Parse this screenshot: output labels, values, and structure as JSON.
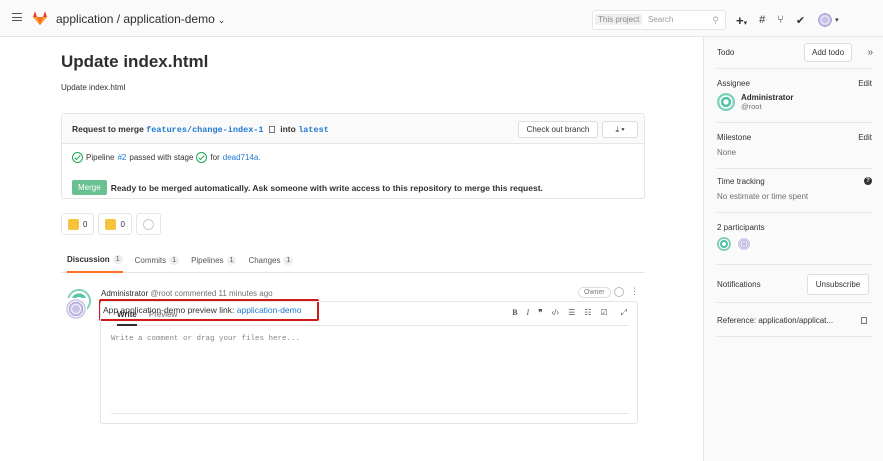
{
  "topbar": {
    "project_path": "application / application-demo",
    "search_scope": "This project",
    "search_placeholder": "Search"
  },
  "mr": {
    "title": "Update index.html",
    "description": "Update index.html",
    "widget": {
      "request_prefix": "Request to merge",
      "source_branch": "features/change-index-1",
      "into": "into",
      "target_branch": "latest",
      "checkout_label": "Check out branch",
      "download_label": "⤓ ▾",
      "pipeline_prefix": "Pipeline",
      "pipeline_id": "#2",
      "pipeline_status": "passed with stage",
      "pipeline_for": "for",
      "commit_sha": "dead714a.",
      "merge_label": "Merge",
      "merge_message": "Ready to be merged automatically. Ask someone with write access to this repository to merge this request."
    },
    "awards": {
      "thumbsup_count": "0",
      "thumbsdown_count": "0"
    },
    "tabs": [
      {
        "label": "Discussion",
        "count": "1"
      },
      {
        "label": "Commits",
        "count": "1"
      },
      {
        "label": "Pipelines",
        "count": "1"
      },
      {
        "label": "Changes",
        "count": "1"
      }
    ],
    "note": {
      "author": "Administrator",
      "meta": "@root commented 11 minutes ago",
      "role": "Owner",
      "body_prefix": "App application-demo preview link:",
      "body_link": "application-demo"
    },
    "editor": {
      "write_tab": "Write",
      "preview_tab": "Preview",
      "placeholder": "Write a comment or drag your files here..."
    }
  },
  "sidebar": {
    "todo_label": "Todo",
    "add_todo": "Add todo",
    "collapse": "»",
    "assignee_label": "Assignee",
    "edit": "Edit",
    "assignee_name": "Administrator",
    "assignee_user": "@root",
    "milestone_label": "Milestone",
    "milestone_value": "None",
    "time_label": "Time tracking",
    "time_value": "No estimate or time spent",
    "participants_label": "2 participants",
    "notifications_label": "Notifications",
    "unsubscribe": "Unsubscribe",
    "reference": "Reference: application/applicat..."
  },
  "colors": {
    "accent": "#1f78d1",
    "success": "#1aaa55",
    "merge_button": "#69c090",
    "highlight_box": "#d0191a",
    "active_tab": "#fc6d26"
  }
}
